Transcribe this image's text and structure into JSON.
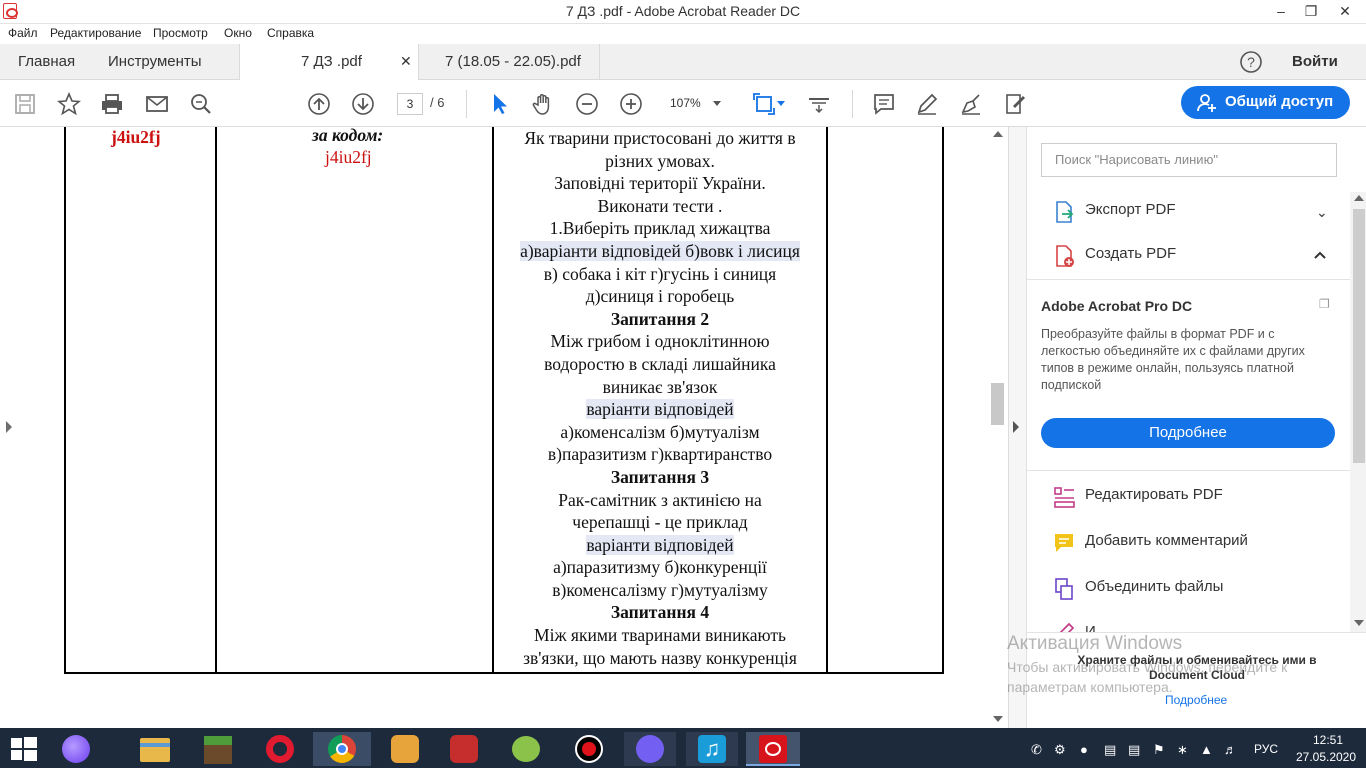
{
  "window": {
    "title": "7 ДЗ .pdf - Adobe Acrobat Reader DC"
  },
  "menu": [
    "Файл",
    "Редактирование",
    "Просмотр",
    "Окно",
    "Справка"
  ],
  "tabs": {
    "home": "Главная",
    "tools": "Инструменты",
    "active_doc": "7 ДЗ .pdf",
    "other_doc": "7 (18.05 - 22.05).pdf",
    "signin": "Войти"
  },
  "toolbar": {
    "page_current": "3",
    "page_total": "/ 6",
    "zoom": "107%",
    "share_label": "Общий доступ"
  },
  "document": {
    "col1_code": "j4iu2fj",
    "col2_label": "за кодом:",
    "col2_code": "j4iu2fj",
    "lines": [
      "Як тварини пристосовані до життя в",
      "різних умовах.",
      "Заповідні території України.",
      "Виконати тести .",
      "1.Виберіть приклад хижацтва",
      "а)варіанти відповідей  б)вовк і лисиця",
      "в) собака і кіт   г)гусінь і синиця",
      "д)синиця і горобець",
      "Запитання 2",
      "Між грибом і одноклітинною",
      "водоростю в складі лишайника",
      "виникає зв'язок",
      "варіанти відповідей",
      "а)коменсалізм    б)мутуалізм",
      "в)паразитизм      г)квартиранство",
      "Запитання 3",
      "Рак-самітник з актинією на",
      "черепашці - це приклад",
      "варіанти відповідей",
      "а)паразитизму    б)конкуренції",
      "в)коменсалізму    г)мутуалізму",
      "Запитання 4",
      "Між якими тваринами виникають",
      "зв'язки, що мають назву конкуренція"
    ]
  },
  "right_panel": {
    "search_placeholder": "Поиск \"Нарисовать линию\"",
    "export_pdf": "Экспорт PDF",
    "create_pdf": "Создать PDF",
    "promo_title": "Adobe Acrobat Pro DC",
    "promo_text": "Преобразуйте файлы в формат PDF и с легкостью объединяйте их с файлами других типов в режиме онлайн, пользуясь платной подпиской",
    "promo_button": "Подробнее",
    "edit_pdf": "Редактировать PDF",
    "add_comment": "Добавить комментарий",
    "combine_files": "Объединить файлы",
    "next_item_partial": "И",
    "cloud_text": "Храните файлы и обменивайтесь ими в Document Cloud",
    "cloud_link": "Подробнее"
  },
  "watermark": {
    "title": "Активация Windows",
    "text": "Чтобы активировать Windows, перейдите к параметрам компьютера."
  },
  "taskbar": {
    "lang": "РУС",
    "time": "12:51",
    "date": "27.05.2020"
  },
  "colors": {
    "accent": "#1473e6",
    "code_red": "#cc1111",
    "highlight": "#e4e8f5",
    "taskbar": "#1d2a3c"
  }
}
